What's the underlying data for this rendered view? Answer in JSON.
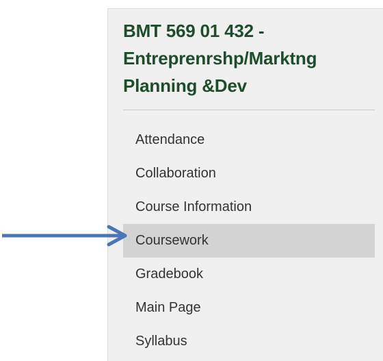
{
  "course": {
    "title": "BMT 569 01 432 - Entreprenrshp/Marktng Planning &Dev"
  },
  "menu": {
    "items": [
      {
        "label": "Attendance",
        "selected": false
      },
      {
        "label": "Collaboration",
        "selected": false
      },
      {
        "label": "Course Information",
        "selected": false
      },
      {
        "label": "Coursework",
        "selected": true
      },
      {
        "label": "Gradebook",
        "selected": false
      },
      {
        "label": "Main Page",
        "selected": false
      },
      {
        "label": "Syllabus",
        "selected": false
      }
    ]
  },
  "annotation": {
    "arrow_icon": "right-arrow-icon",
    "arrow_color": "#4a77b4",
    "points_to": "Coursework"
  },
  "colors": {
    "title": "#1e4d2b",
    "panel_background": "#f0f0f0",
    "selected_background": "#d3d3d3",
    "menu_text": "#333333"
  }
}
